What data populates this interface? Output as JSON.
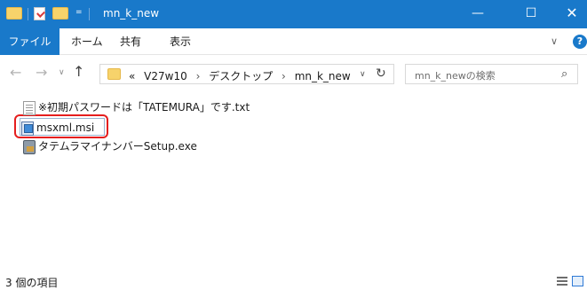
{
  "window": {
    "title": "mn_k_new",
    "qat_dropdown": "=",
    "minimize": "—",
    "maximize": "☐",
    "close": "✕"
  },
  "ribbon": {
    "file_tab": "ファイル",
    "tabs": [
      "ホーム",
      "共有",
      "表示"
    ],
    "expand": "∨",
    "help": "?"
  },
  "nav": {
    "back": "←",
    "forward": "→",
    "recent": "∨",
    "up": "↑"
  },
  "address": {
    "overflow": "«",
    "crumbs": [
      "V27w10",
      "デスクトップ",
      "mn_k_new"
    ],
    "separator": "›",
    "dropdown": "∨",
    "refresh": "↻"
  },
  "search": {
    "placeholder": "mn_k_newの検索",
    "icon": "⌕"
  },
  "files": [
    {
      "name": "※初期パスワードは「TATEMURA」です.txt",
      "icon": "text-file-icon"
    },
    {
      "name": "msxml.msi",
      "icon": "msi-installer-icon",
      "selected": true,
      "highlight_color": "#e51e1e"
    },
    {
      "name": "タテムラマイナンバーSetup.exe",
      "icon": "setup-exe-icon"
    }
  ],
  "status": {
    "item_count": "3 個の項目"
  },
  "colors": {
    "accent": "#1979ca",
    "highlight": "#e51e1e"
  }
}
